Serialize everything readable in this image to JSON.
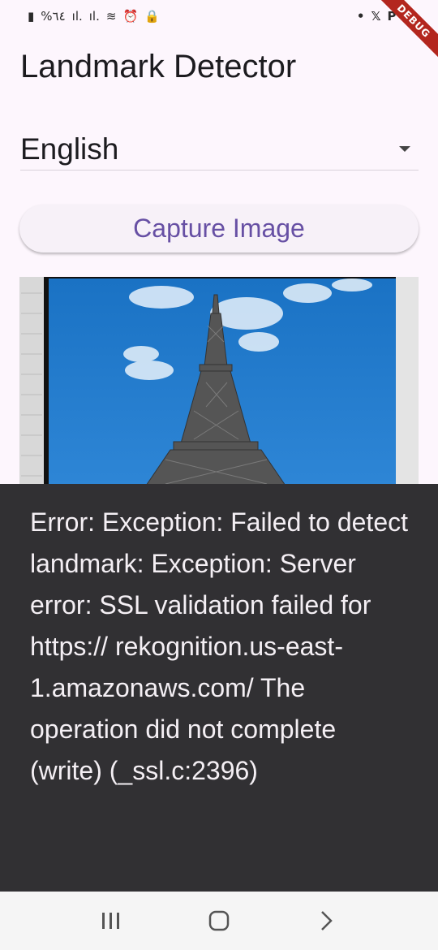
{
  "status_bar": {
    "left_text": "%٦٤",
    "right_icons": [
      "dot",
      "X",
      "P",
      "person-icon"
    ]
  },
  "debug_banner": "DEBUG",
  "app": {
    "title": "Landmark Detector",
    "language_dropdown": {
      "selected": "English"
    },
    "capture_button_label": "Capture Image",
    "error_message": "Error: Exception: Failed to detect landmark: Exception: Server error: SSL validation failed for https:// rekognition.us-east-1.amazonaws.com/ The operation did not complete (write) (_ssl.c:2396)"
  },
  "nav": {
    "buttons": [
      "recent-apps",
      "home",
      "back"
    ]
  },
  "colors": {
    "background": "#fdf6fd",
    "primary": "#6750a4",
    "error_panel": "#313033",
    "debug_red": "#b3261e"
  }
}
